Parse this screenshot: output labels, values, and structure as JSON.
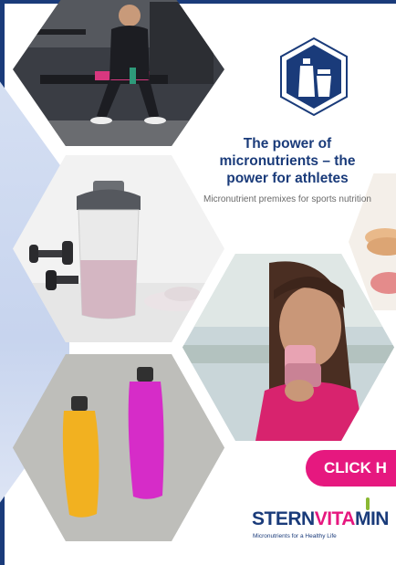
{
  "ad": {
    "headline": "The power of micronutrients – the power for athletes",
    "subheadline": "Micronutrient premixes for sports nutrition",
    "cta_label": "CLICK H",
    "logo": {
      "part1": "STERN",
      "part2": "VITA",
      "part3": "MIN",
      "tagline": "Micronutrients for a Healthy Life"
    }
  },
  "images": [
    {
      "name": "athlete-gym-photo",
      "subject": "athlete sitting in gym"
    },
    {
      "name": "shaker-bottle-photo",
      "subject": "protein shaker with dumbbells"
    },
    {
      "name": "woman-eating-bar-photo",
      "subject": "woman eating a snack bar"
    },
    {
      "name": "sports-drinks-photo",
      "subject": "yellow and pink sports drink bottles"
    }
  ],
  "colors": {
    "brand_blue": "#1a3b7a",
    "brand_pink": "#e6187f",
    "leaf_green": "#8ab833"
  },
  "icons": [
    "bottle-shaker-icon"
  ]
}
